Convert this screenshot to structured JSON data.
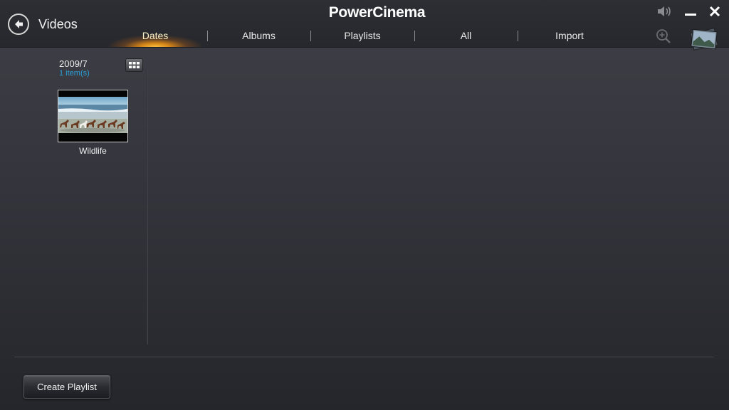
{
  "app": {
    "title": "PowerCinema"
  },
  "header": {
    "section_title": "Videos"
  },
  "tabs": [
    {
      "label": "Dates",
      "active": true
    },
    {
      "label": "Albums",
      "active": false
    },
    {
      "label": "Playlists",
      "active": false
    },
    {
      "label": "All",
      "active": false
    },
    {
      "label": "Import",
      "active": false
    }
  ],
  "icons": {
    "back": "back-arrow-icon",
    "volume": "speaker-icon",
    "minimize": "minimize-icon",
    "close": "close-icon",
    "zoom": "zoom-in-icon",
    "grid": "grid-view-icon",
    "slideshow": "photo-stack-icon"
  },
  "sidebar": {
    "date": "2009/7",
    "count": "1 item(s)"
  },
  "items": [
    {
      "caption": "Wildlife"
    }
  ],
  "footer": {
    "create_playlist_label": "Create Playlist"
  },
  "colors": {
    "accent": "#f5a623",
    "count_text": "#2a9fd6",
    "background": "#34353c"
  }
}
